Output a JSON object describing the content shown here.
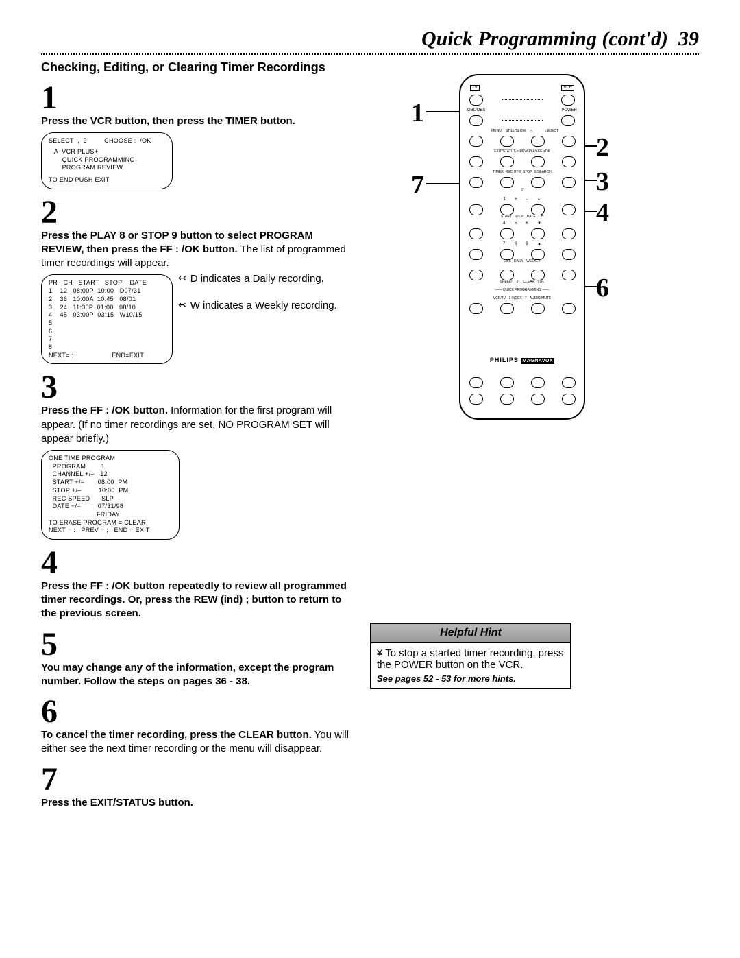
{
  "page": {
    "title": "Quick Programming (cont'd)",
    "number": "39"
  },
  "section_heading": "Checking, Editing, or Clearing Timer Recordings",
  "steps": {
    "n1": "1",
    "t1": "Press the VCR button, then press the TIMER button.",
    "n2": "2",
    "t2a": "Press the PLAY 8 or STOP 9 button to select PROGRAM REVIEW, then press the FF : /OK button.",
    "t2b": " The list of programmed timer recordings will appear.",
    "legend_d": "D indicates a Daily recording.",
    "legend_w": "W indicates a Weekly recording.",
    "n3": "3",
    "t3a": "Press the FF : /OK button.",
    "t3b": " Information for the first program will appear. (If no timer recordings are set, NO PROGRAM SET will appear briefly.)",
    "n4": "4",
    "t4": "Press the FF : /OK button repeatedly to review all programmed timer recordings. Or, press the REW (ind) ; button to return to the previous screen.",
    "n5": "5",
    "t5": "You may change any of the information, except the program number.  Follow the steps on pages 36 - 38.",
    "n6": "6",
    "t6a": "To cancel the timer recording, press the CLEAR button.",
    "t6b": " You will either see the next timer recording or the menu will disappear.",
    "n7": "7",
    "t7": "Press the EXIT/STATUS button."
  },
  "osd1": {
    "line1": "SELECT  ,  9         CHOOSE :  /OK",
    "line2": "   A  VCR PLUS+",
    "line3": "       QUICK PROGRAMMING",
    "line4": "       PROGRAM REVIEW",
    "line5": "TO END PUSH EXIT"
  },
  "osd2": {
    "header": "PR   CH   START   STOP    DATE",
    "r1": "1    12   08:00P  10:00   D07/31",
    "r2": "2    36   10:00A  10:45   08/01",
    "r3": "3    24   11:30P  01:00   08/10",
    "r4": "4    45   03:00P  03:15   W10/15",
    "r5": "5",
    "r6": "6",
    "r7": "7",
    "r8": "8",
    "footer": "NEXT= :                    END=EXIT"
  },
  "osd3": {
    "l1": "ONE TIME PROGRAM",
    "l2": "  PROGRAM        1",
    "l3": "  CHANNEL +/–   12",
    "l4": "  START +/–       08:00  PM",
    "l5": "  STOP +/–         10:00  PM",
    "l6": "  REC SPEED      SLP",
    "l7": "  DATE +/–         07/31/98",
    "l8": "                         FRIDAY",
    "l9": "TO ERASE PROGRAM = CLEAR",
    "l10": "NEXT = :   PREV = ;   END = EXIT"
  },
  "remote": {
    "brand1": "PHILIPS",
    "brand2": "MAGNAVOX",
    "labels": {
      "tv": "TV",
      "vcr": "VCR",
      "obl": "OBL/OBS",
      "power": "POWER",
      "menu": "MENU",
      "still": "STILL/SLOW",
      "eject": "c EJECT",
      "exit": "EXIT/STATUS",
      "rew": "< REW",
      "play": "PLAY",
      "ff": "FF >",
      "ok": "OK",
      "timer": "TIMER",
      "rec": "REC OTR",
      "stop": "STOP",
      "ssearch": "S.SEARCH",
      "start": "START",
      "stop2": "STOP",
      "date": "DATE",
      "ch": "CH",
      "obs": "OBS",
      "daily": "DAILY",
      "weekly": "WEEKLY",
      "speed": "SPEED",
      "clear": "CLEAR",
      "vol": "VOL",
      "qp": "QUICK PROGRAMMING",
      "vcrtv": "VCR/TV",
      "index": "7  INDEX  : 7",
      "audio": "AUDIO/MUTE"
    },
    "callouts": {
      "c1": "1",
      "c2": "2",
      "c3": "3",
      "c4": "4",
      "c6": "6",
      "c7": "7"
    }
  },
  "hint": {
    "title": "Helpful Hint",
    "body": "¥ To stop a started timer recording, press the POWER button on the VCR.",
    "footer": "See pages 52 - 53 for more hints."
  }
}
